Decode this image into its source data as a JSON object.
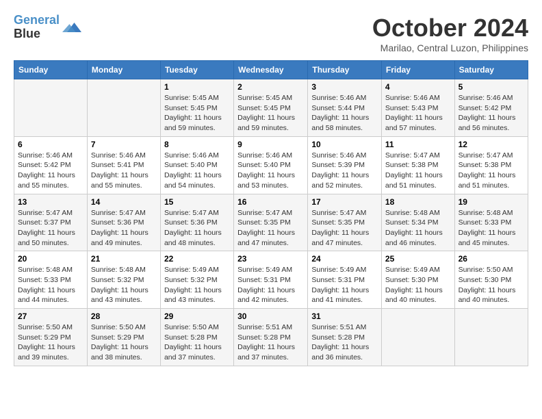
{
  "header": {
    "logo_line1": "General",
    "logo_line2": "Blue",
    "month": "October 2024",
    "location": "Marilao, Central Luzon, Philippines"
  },
  "weekdays": [
    "Sunday",
    "Monday",
    "Tuesday",
    "Wednesday",
    "Thursday",
    "Friday",
    "Saturday"
  ],
  "weeks": [
    [
      {
        "day": "",
        "sunrise": "",
        "sunset": "",
        "daylight": ""
      },
      {
        "day": "",
        "sunrise": "",
        "sunset": "",
        "daylight": ""
      },
      {
        "day": "1",
        "sunrise": "Sunrise: 5:45 AM",
        "sunset": "Sunset: 5:45 PM",
        "daylight": "Daylight: 11 hours and 59 minutes."
      },
      {
        "day": "2",
        "sunrise": "Sunrise: 5:45 AM",
        "sunset": "Sunset: 5:45 PM",
        "daylight": "Daylight: 11 hours and 59 minutes."
      },
      {
        "day": "3",
        "sunrise": "Sunrise: 5:46 AM",
        "sunset": "Sunset: 5:44 PM",
        "daylight": "Daylight: 11 hours and 58 minutes."
      },
      {
        "day": "4",
        "sunrise": "Sunrise: 5:46 AM",
        "sunset": "Sunset: 5:43 PM",
        "daylight": "Daylight: 11 hours and 57 minutes."
      },
      {
        "day": "5",
        "sunrise": "Sunrise: 5:46 AM",
        "sunset": "Sunset: 5:42 PM",
        "daylight": "Daylight: 11 hours and 56 minutes."
      }
    ],
    [
      {
        "day": "6",
        "sunrise": "Sunrise: 5:46 AM",
        "sunset": "Sunset: 5:42 PM",
        "daylight": "Daylight: 11 hours and 55 minutes."
      },
      {
        "day": "7",
        "sunrise": "Sunrise: 5:46 AM",
        "sunset": "Sunset: 5:41 PM",
        "daylight": "Daylight: 11 hours and 55 minutes."
      },
      {
        "day": "8",
        "sunrise": "Sunrise: 5:46 AM",
        "sunset": "Sunset: 5:40 PM",
        "daylight": "Daylight: 11 hours and 54 minutes."
      },
      {
        "day": "9",
        "sunrise": "Sunrise: 5:46 AM",
        "sunset": "Sunset: 5:40 PM",
        "daylight": "Daylight: 11 hours and 53 minutes."
      },
      {
        "day": "10",
        "sunrise": "Sunrise: 5:46 AM",
        "sunset": "Sunset: 5:39 PM",
        "daylight": "Daylight: 11 hours and 52 minutes."
      },
      {
        "day": "11",
        "sunrise": "Sunrise: 5:47 AM",
        "sunset": "Sunset: 5:38 PM",
        "daylight": "Daylight: 11 hours and 51 minutes."
      },
      {
        "day": "12",
        "sunrise": "Sunrise: 5:47 AM",
        "sunset": "Sunset: 5:38 PM",
        "daylight": "Daylight: 11 hours and 51 minutes."
      }
    ],
    [
      {
        "day": "13",
        "sunrise": "Sunrise: 5:47 AM",
        "sunset": "Sunset: 5:37 PM",
        "daylight": "Daylight: 11 hours and 50 minutes."
      },
      {
        "day": "14",
        "sunrise": "Sunrise: 5:47 AM",
        "sunset": "Sunset: 5:36 PM",
        "daylight": "Daylight: 11 hours and 49 minutes."
      },
      {
        "day": "15",
        "sunrise": "Sunrise: 5:47 AM",
        "sunset": "Sunset: 5:36 PM",
        "daylight": "Daylight: 11 hours and 48 minutes."
      },
      {
        "day": "16",
        "sunrise": "Sunrise: 5:47 AM",
        "sunset": "Sunset: 5:35 PM",
        "daylight": "Daylight: 11 hours and 47 minutes."
      },
      {
        "day": "17",
        "sunrise": "Sunrise: 5:47 AM",
        "sunset": "Sunset: 5:35 PM",
        "daylight": "Daylight: 11 hours and 47 minutes."
      },
      {
        "day": "18",
        "sunrise": "Sunrise: 5:48 AM",
        "sunset": "Sunset: 5:34 PM",
        "daylight": "Daylight: 11 hours and 46 minutes."
      },
      {
        "day": "19",
        "sunrise": "Sunrise: 5:48 AM",
        "sunset": "Sunset: 5:33 PM",
        "daylight": "Daylight: 11 hours and 45 minutes."
      }
    ],
    [
      {
        "day": "20",
        "sunrise": "Sunrise: 5:48 AM",
        "sunset": "Sunset: 5:33 PM",
        "daylight": "Daylight: 11 hours and 44 minutes."
      },
      {
        "day": "21",
        "sunrise": "Sunrise: 5:48 AM",
        "sunset": "Sunset: 5:32 PM",
        "daylight": "Daylight: 11 hours and 43 minutes."
      },
      {
        "day": "22",
        "sunrise": "Sunrise: 5:49 AM",
        "sunset": "Sunset: 5:32 PM",
        "daylight": "Daylight: 11 hours and 43 minutes."
      },
      {
        "day": "23",
        "sunrise": "Sunrise: 5:49 AM",
        "sunset": "Sunset: 5:31 PM",
        "daylight": "Daylight: 11 hours and 42 minutes."
      },
      {
        "day": "24",
        "sunrise": "Sunrise: 5:49 AM",
        "sunset": "Sunset: 5:31 PM",
        "daylight": "Daylight: 11 hours and 41 minutes."
      },
      {
        "day": "25",
        "sunrise": "Sunrise: 5:49 AM",
        "sunset": "Sunset: 5:30 PM",
        "daylight": "Daylight: 11 hours and 40 minutes."
      },
      {
        "day": "26",
        "sunrise": "Sunrise: 5:50 AM",
        "sunset": "Sunset: 5:30 PM",
        "daylight": "Daylight: 11 hours and 40 minutes."
      }
    ],
    [
      {
        "day": "27",
        "sunrise": "Sunrise: 5:50 AM",
        "sunset": "Sunset: 5:29 PM",
        "daylight": "Daylight: 11 hours and 39 minutes."
      },
      {
        "day": "28",
        "sunrise": "Sunrise: 5:50 AM",
        "sunset": "Sunset: 5:29 PM",
        "daylight": "Daylight: 11 hours and 38 minutes."
      },
      {
        "day": "29",
        "sunrise": "Sunrise: 5:50 AM",
        "sunset": "Sunset: 5:28 PM",
        "daylight": "Daylight: 11 hours and 37 minutes."
      },
      {
        "day": "30",
        "sunrise": "Sunrise: 5:51 AM",
        "sunset": "Sunset: 5:28 PM",
        "daylight": "Daylight: 11 hours and 37 minutes."
      },
      {
        "day": "31",
        "sunrise": "Sunrise: 5:51 AM",
        "sunset": "Sunset: 5:28 PM",
        "daylight": "Daylight: 11 hours and 36 minutes."
      },
      {
        "day": "",
        "sunrise": "",
        "sunset": "",
        "daylight": ""
      },
      {
        "day": "",
        "sunrise": "",
        "sunset": "",
        "daylight": ""
      }
    ]
  ]
}
